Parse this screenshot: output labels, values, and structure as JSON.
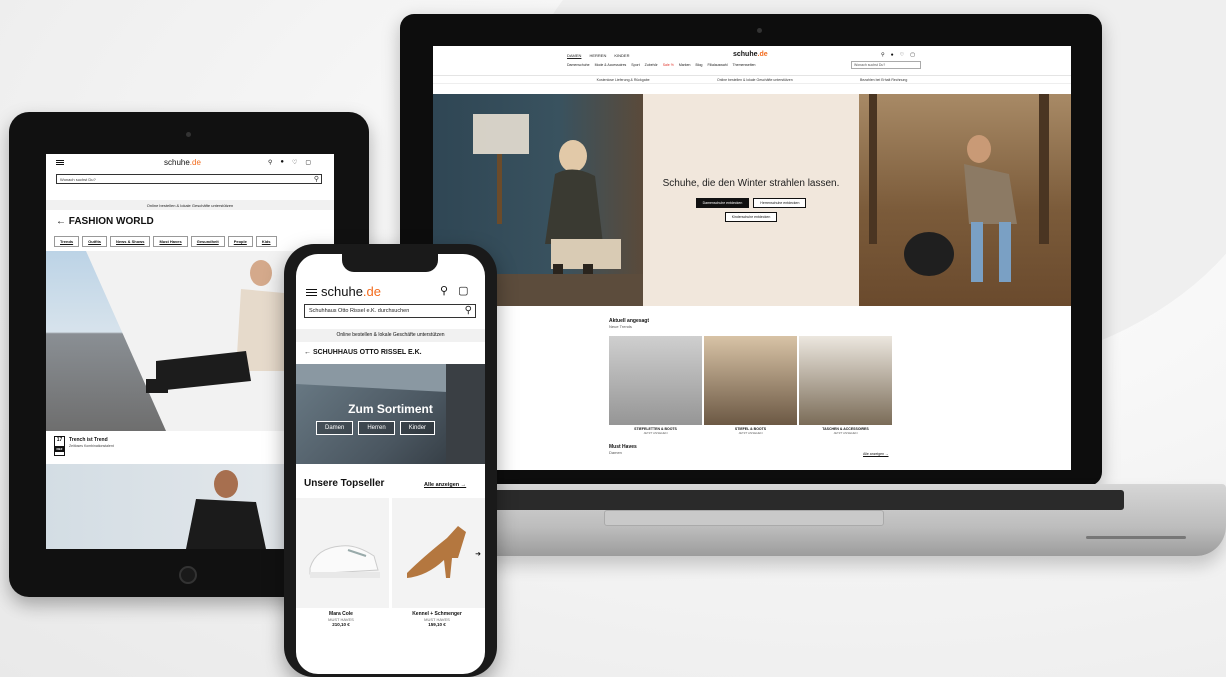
{
  "laptop": {
    "gender_tabs": [
      "DAMEN",
      "HERREN",
      "KINDER"
    ],
    "logo": {
      "text": "schuhe",
      "accent": ".de"
    },
    "nav": [
      "Damenschuhe",
      "Mode & Accessoires",
      "Sport",
      "Zubehör",
      "Sale %",
      "Marken",
      "Blog",
      "Filialauswahl",
      "Themenwelten"
    ],
    "search_placeholder": "Wonach suchst Du?",
    "strip": [
      "Kostenlose Lieferung & Rückgabe",
      "Online bestellen & lokale Geschäfte unterstützen",
      "Bezahlen bei Erhalt Rechnung"
    ],
    "hero_title": "Schuhe, die den Winter strahlen lassen.",
    "hero_buttons": [
      "Damenschuhe entdecken",
      "Herrenschuhe entdecken",
      "Kinderschuhe entdecken"
    ],
    "section1_title": "Aktuell angesagt",
    "section1_sub": "Neue Trends",
    "tiles": [
      {
        "label": "STIEFELETTEN & BOOTS",
        "sub": "JETZT ANSEHEN"
      },
      {
        "label": "STIEFEL & BOOTS",
        "sub": "JETZT ANSEHEN"
      },
      {
        "label": "TASCHEN & ACCESSOIRES",
        "sub": "JETZT ANSEHEN"
      }
    ],
    "section2_title": "Must Haves",
    "section2_sub": "Damen",
    "show_all": "Alle anzeigen →"
  },
  "tablet": {
    "logo": {
      "text": "schuhe",
      "accent": ".de"
    },
    "search_placeholder": "Wonach suchst Du?",
    "strip": "Online bestellen & lokale Geschäfte unterstützen",
    "page_title": "FASHION WORLD",
    "tabs": [
      "Trends",
      "Outfits",
      "News & Shows",
      "Must Haves",
      "Gesundheit",
      "People",
      "Kids"
    ],
    "article_day": "17",
    "article_month": "DEZ",
    "article_title": "Trench ist Trend",
    "article_sub": "Zeitloses Kombinationstalent"
  },
  "phone": {
    "logo": {
      "text": "schuhe",
      "accent": ".de"
    },
    "search_placeholder": "Schuhhaus Otto Rissel e.K. durchsuchen",
    "strip": "Online bestellen & lokale Geschäfte unterstützen",
    "store_title": "SCHUHHAUS OTTO RISSEL E.K.",
    "hero_title": "Zum Sortiment",
    "hero_buttons": [
      "Damen",
      "Herren",
      "Kinder"
    ],
    "topseller_title": "Unsere Topseller",
    "show_all": "Alle anzeigen →",
    "products": [
      {
        "brand": "Mara Cole",
        "tag": "MUST HAVES",
        "price": "210,10 €"
      },
      {
        "brand": "Kennel + Schmenger",
        "tag": "MUST HAVES",
        "price": "159,10 €"
      }
    ]
  }
}
